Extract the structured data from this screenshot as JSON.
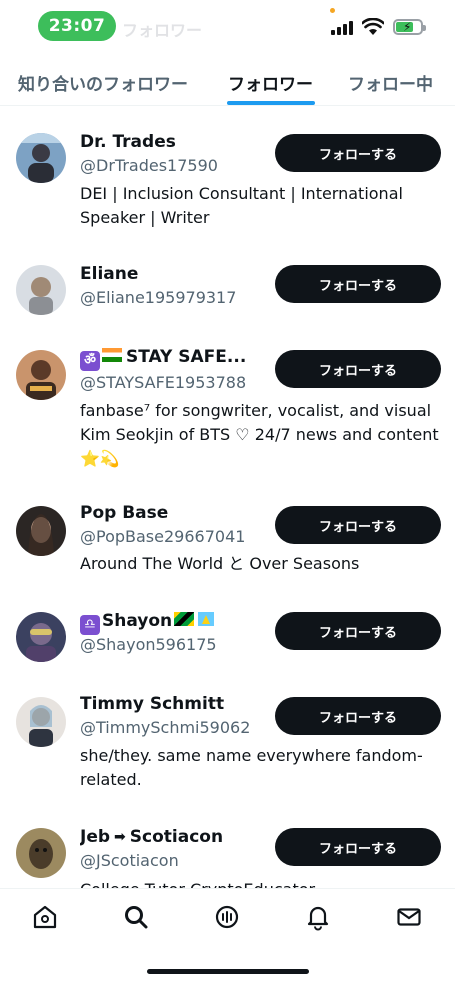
{
  "status_bar": {
    "time": "23:07",
    "ghost_title": "フォロワー"
  },
  "tabs": [
    {
      "label": "知り合いのフォロワー"
    },
    {
      "label": "フォロワー"
    },
    {
      "label": "フォロー中"
    }
  ],
  "follow_label": "フォローする",
  "users": [
    {
      "name": "Dr. Trades",
      "handle": "@DrTrades17590",
      "bio": "DEI | Inclusion Consultant | International Speaker | Writer"
    },
    {
      "name": "Eliane",
      "handle": "@Eliane195979317",
      "bio": ""
    },
    {
      "name_prefix": "ॐ",
      "name": "STAY SAFE...",
      "handle": "@STAYSAFE1953788",
      "bio": "fanbase⁷ for songwriter, vocalist, and visual Kim Seokjin of BTS ♡ 24/7 news and content ⭐💫"
    },
    {
      "name": "Pop Base",
      "handle": "@PopBase29667041",
      "bio": "Around The World と Over Seasons"
    },
    {
      "name_prefix": "♎",
      "name": "Shayon",
      "handle": "@Shayon596175",
      "bio": ""
    },
    {
      "name": "Timmy Schmitt",
      "handle": "@TimmySchmi59062",
      "bio": "she/they. same name everywhere fandom-related."
    },
    {
      "name_a": "Jeb",
      "name_arrow": "➡",
      "name_b": "Scotiacon",
      "handle": "@JScotiacon",
      "bio": "College Tutor CryptoEducator"
    }
  ],
  "nav": [
    {
      "icon": "home-icon"
    },
    {
      "icon": "search-icon"
    },
    {
      "icon": "spaces-icon"
    },
    {
      "icon": "bell-icon"
    },
    {
      "icon": "mail-icon"
    }
  ]
}
